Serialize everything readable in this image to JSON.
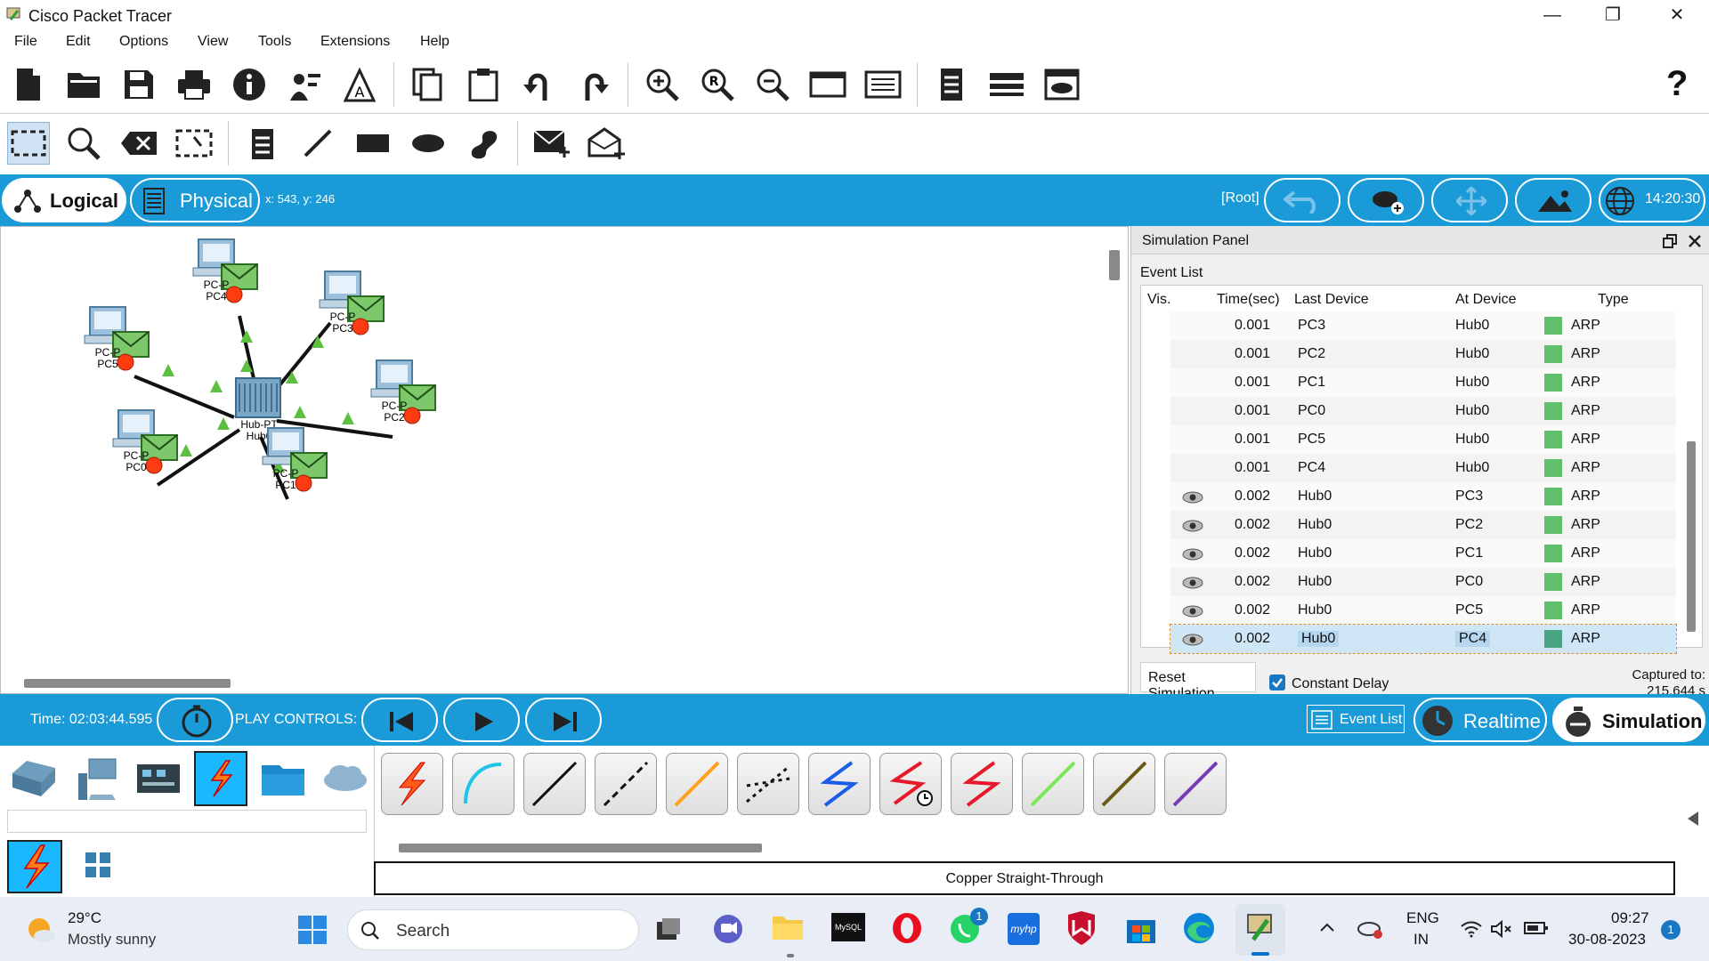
{
  "window": {
    "title": "Cisco Packet Tracer",
    "minimize": "—",
    "maximize": "❐",
    "close": "✕"
  },
  "menu": [
    "File",
    "Edit",
    "Options",
    "View",
    "Tools",
    "Extensions",
    "Help"
  ],
  "help_glyph": "?",
  "view_tabs": {
    "logical": "Logical",
    "physical": "Physical",
    "coords": "x: 543, y: 246"
  },
  "root_label": "[Root]",
  "clock": "14:20:30",
  "devices": [
    {
      "line1": "PC-P",
      "line2": "PC4"
    },
    {
      "line1": "PC-P",
      "line2": "PC3"
    },
    {
      "line1": "PC-P",
      "line2": "PC5"
    },
    {
      "line1": "PC-P",
      "line2": "PC2"
    },
    {
      "line1": "PC-P",
      "line2": "PC0"
    },
    {
      "line1": "PC-P",
      "line2": "PC1"
    }
  ],
  "hub": {
    "line1": "Hub-PT",
    "line2": "Hub0"
  },
  "sim_panel": {
    "title": "Simulation Panel",
    "event_list_label": "Event List",
    "columns": {
      "vis": "Vis.",
      "time": "Time(sec)",
      "last": "Last Device",
      "at": "At Device",
      "type": "Type"
    },
    "events": [
      {
        "time": "0.001",
        "last": "PC3",
        "at": "Hub0",
        "type": "ARP",
        "vis": false,
        "selected": false
      },
      {
        "time": "0.001",
        "last": "PC2",
        "at": "Hub0",
        "type": "ARP",
        "vis": false,
        "selected": false
      },
      {
        "time": "0.001",
        "last": "PC1",
        "at": "Hub0",
        "type": "ARP",
        "vis": false,
        "selected": false
      },
      {
        "time": "0.001",
        "last": "PC0",
        "at": "Hub0",
        "type": "ARP",
        "vis": false,
        "selected": false
      },
      {
        "time": "0.001",
        "last": "PC5",
        "at": "Hub0",
        "type": "ARP",
        "vis": false,
        "selected": false
      },
      {
        "time": "0.001",
        "last": "PC4",
        "at": "Hub0",
        "type": "ARP",
        "vis": false,
        "selected": false
      },
      {
        "time": "0.002",
        "last": "Hub0",
        "at": "PC3",
        "type": "ARP",
        "vis": true,
        "selected": false
      },
      {
        "time": "0.002",
        "last": "Hub0",
        "at": "PC2",
        "type": "ARP",
        "vis": true,
        "selected": false
      },
      {
        "time": "0.002",
        "last": "Hub0",
        "at": "PC1",
        "type": "ARP",
        "vis": true,
        "selected": false
      },
      {
        "time": "0.002",
        "last": "Hub0",
        "at": "PC0",
        "type": "ARP",
        "vis": true,
        "selected": false
      },
      {
        "time": "0.002",
        "last": "Hub0",
        "at": "PC5",
        "type": "ARP",
        "vis": true,
        "selected": false
      },
      {
        "time": "0.002",
        "last": "Hub0",
        "at": "PC4",
        "type": "ARP",
        "vis": true,
        "selected": true
      }
    ],
    "reset_label": "Reset Simulation",
    "constant_delay_label": "Constant Delay",
    "constant_delay_checked": true,
    "captured_label": "Captured to:",
    "captured_value": "215.644 s"
  },
  "bottom_bar": {
    "time": "Time: 02:03:44.595",
    "play_controls": "PLAY CONTROLS:",
    "event_list": "Event List",
    "realtime": "Realtime",
    "simulation": "Simulation"
  },
  "cable_label": "Copper Straight-Through",
  "colors": {
    "accent": "#1a9ad6",
    "arp": "#5fbf6a",
    "selected_row": "#cfe6f7"
  },
  "taskbar": {
    "weather_temp": "29°C",
    "weather_desc": "Mostly sunny",
    "search": "Search",
    "lang1": "ENG",
    "lang2": "IN",
    "time": "09:27",
    "date": "30-08-2023",
    "whatsapp_badge": "1",
    "notif_badge": "1",
    "mysql": "MySQL",
    "hp": "myhp"
  }
}
